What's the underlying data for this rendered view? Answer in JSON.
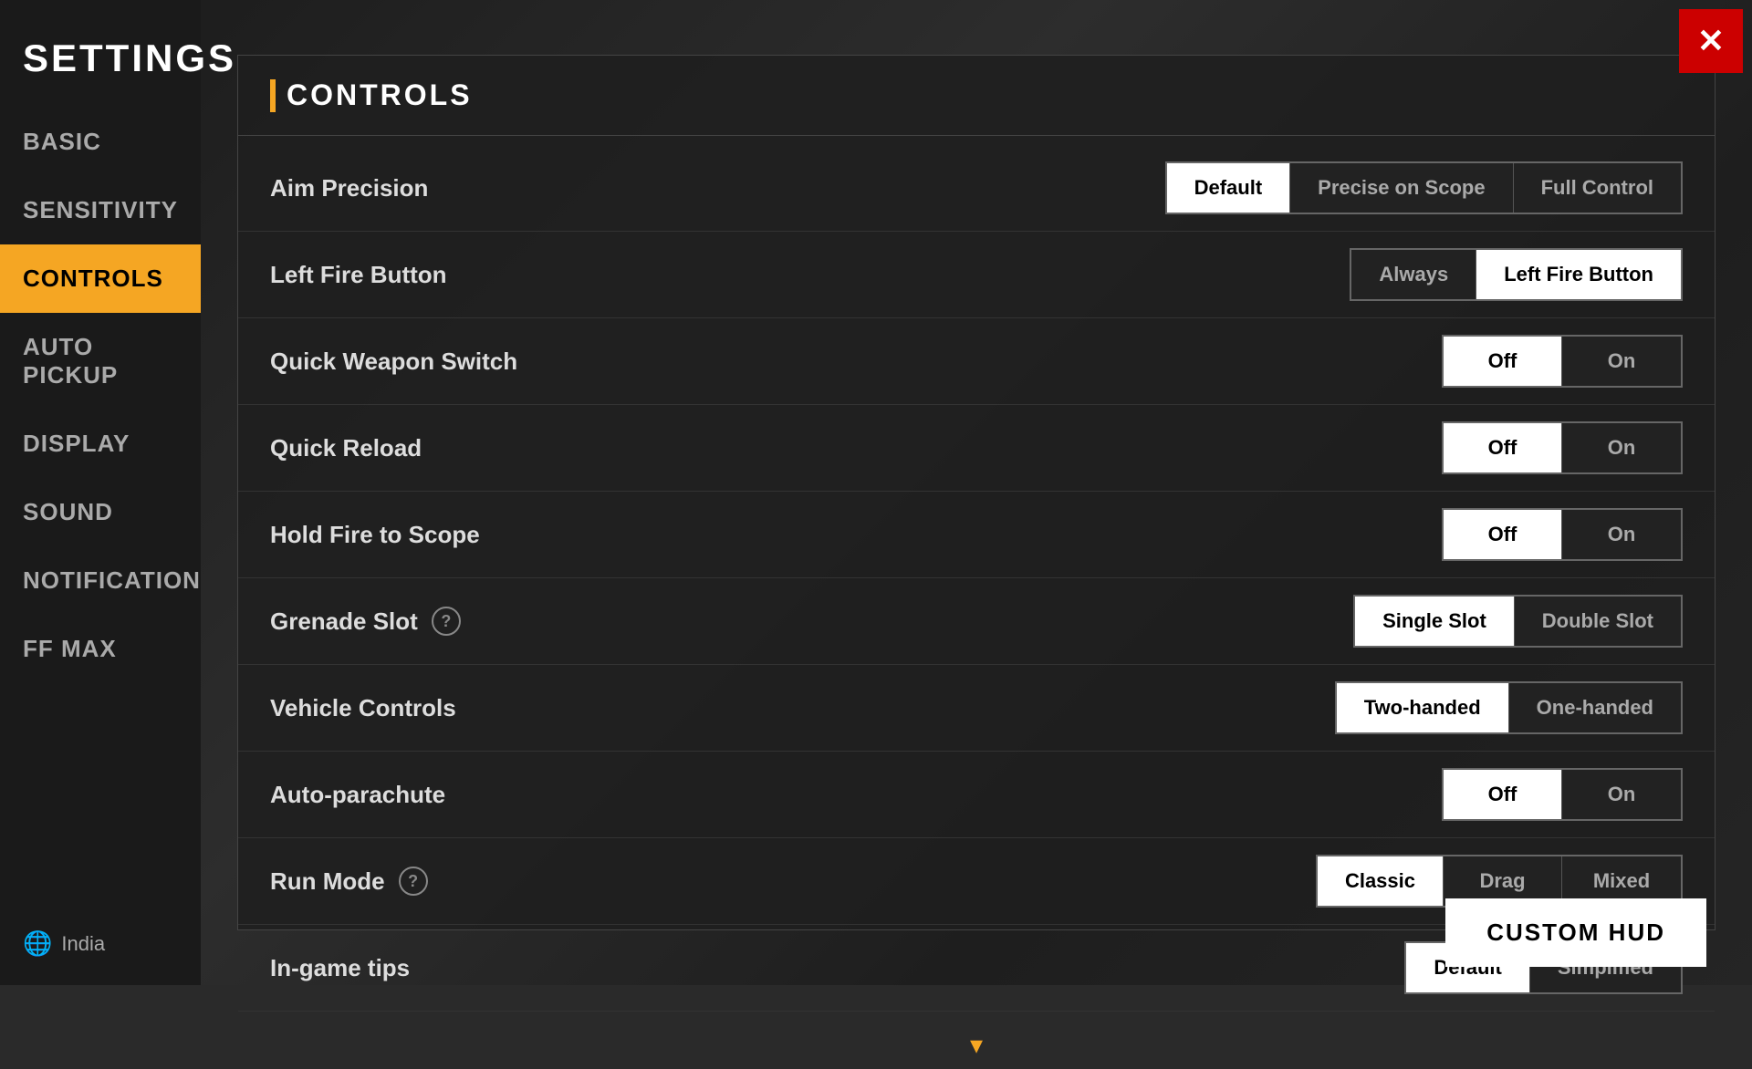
{
  "sidebar": {
    "title": "SETTINGS",
    "items": [
      {
        "id": "basic",
        "label": "BASIC",
        "active": false
      },
      {
        "id": "sensitivity",
        "label": "SENSITIVITY",
        "active": false
      },
      {
        "id": "controls",
        "label": "CONTROLS",
        "active": true
      },
      {
        "id": "auto-pickup",
        "label": "AUTO PICKUP",
        "active": false
      },
      {
        "id": "display",
        "label": "DISPLAY",
        "active": false
      },
      {
        "id": "sound",
        "label": "SOUND",
        "active": false
      },
      {
        "id": "notification",
        "label": "NOTIFICATION",
        "active": false
      },
      {
        "id": "ff-max",
        "label": "FF MAX",
        "active": false
      }
    ],
    "footer": {
      "region": "India"
    }
  },
  "section": {
    "title": "CONTROLS"
  },
  "settings": [
    {
      "id": "aim-precision",
      "label": "Aim Precision",
      "help": false,
      "options": [
        "Default",
        "Precise on Scope",
        "Full Control"
      ],
      "active": "Default"
    },
    {
      "id": "left-fire-button",
      "label": "Left Fire Button",
      "help": false,
      "options": [
        "Always",
        "Left Fire Button"
      ],
      "active": "Left Fire Button"
    },
    {
      "id": "quick-weapon-switch",
      "label": "Quick Weapon Switch",
      "help": false,
      "options": [
        "Off",
        "On"
      ],
      "active": "Off"
    },
    {
      "id": "quick-reload",
      "label": "Quick Reload",
      "help": false,
      "options": [
        "Off",
        "On"
      ],
      "active": "Off"
    },
    {
      "id": "hold-fire-to-scope",
      "label": "Hold Fire to Scope",
      "help": false,
      "options": [
        "Off",
        "On"
      ],
      "active": "Off"
    },
    {
      "id": "grenade-slot",
      "label": "Grenade Slot",
      "help": true,
      "options": [
        "Single Slot",
        "Double Slot"
      ],
      "active": "Single Slot"
    },
    {
      "id": "vehicle-controls",
      "label": "Vehicle Controls",
      "help": false,
      "options": [
        "Two-handed",
        "One-handed"
      ],
      "active": "Two-handed"
    },
    {
      "id": "auto-parachute",
      "label": "Auto-parachute",
      "help": false,
      "options": [
        "Off",
        "On"
      ],
      "active": "Off"
    },
    {
      "id": "run-mode",
      "label": "Run Mode",
      "help": true,
      "options": [
        "Classic",
        "Drag",
        "Mixed"
      ],
      "active": "Classic"
    },
    {
      "id": "in-game-tips",
      "label": "In-game tips",
      "help": false,
      "options": [
        "Default",
        "Simplified"
      ],
      "active": "Default"
    }
  ],
  "ui": {
    "close_label": "✕",
    "custom_hud_label": "CUSTOM HUD",
    "scroll_down": "▾",
    "help_char": "?",
    "globe_char": "🌐"
  }
}
